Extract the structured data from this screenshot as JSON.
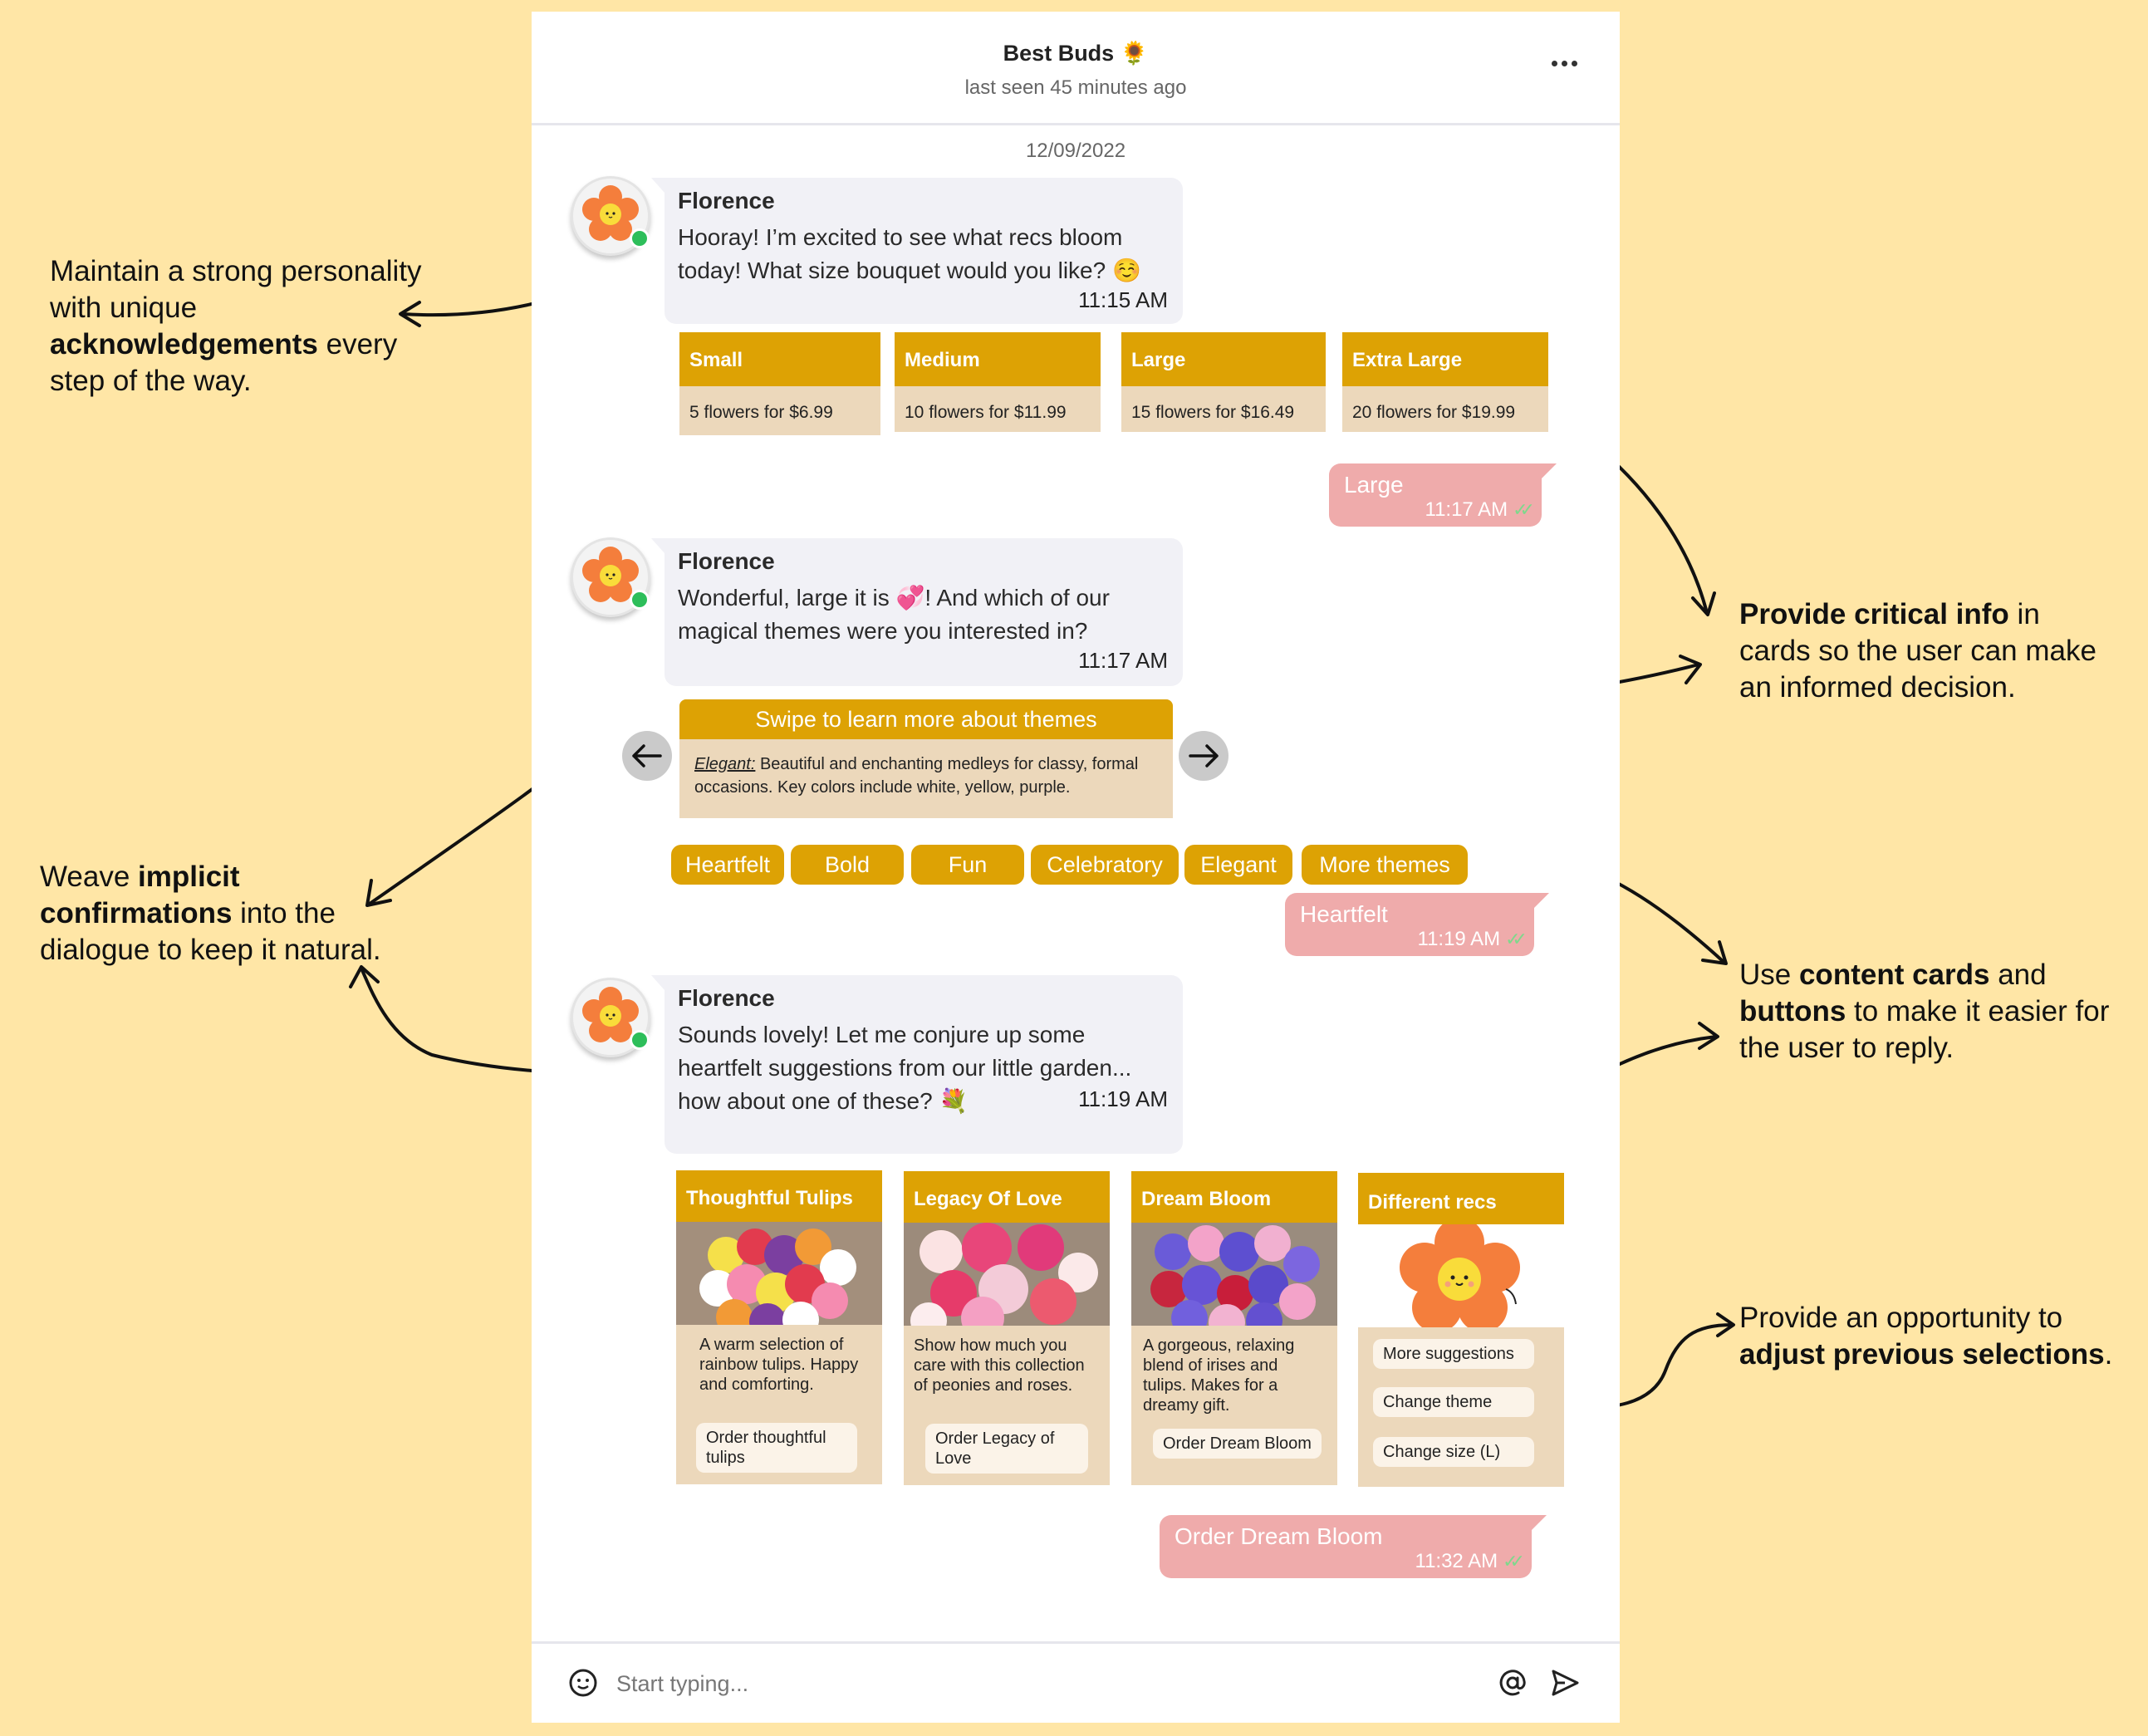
{
  "header": {
    "title": "Best Buds 🌻",
    "subtitle": "last seen 45 minutes ago",
    "more_icon": "ellipsis-icon"
  },
  "date": "12/09/2022",
  "bot": {
    "name": "Florence",
    "status": "online",
    "avatar_icon": "smiling-flower-icon"
  },
  "messages": {
    "m1": {
      "sender": "Florence",
      "text": "Hooray! I’m excited to see what recs bloom today! What size bouquet would you like? ☺️",
      "time": "11:15 AM"
    },
    "m2": {
      "sender": "Florence",
      "text": "Wonderful, large it is 💞! And which of our magical themes were you interested in?",
      "time": "11:17 AM"
    },
    "m3": {
      "sender": "Florence",
      "text": "Sounds lovely! Let me conjure up some heartfelt suggestions from our little garden... how about one of these? 💐",
      "time": "11:19 AM"
    }
  },
  "size_cards": [
    {
      "title": "Small",
      "detail": "5 flowers for $6.99"
    },
    {
      "title": "Medium",
      "detail": "10 flowers for $11.99"
    },
    {
      "title": "Large",
      "detail": "15 flowers for $16.49"
    },
    {
      "title": "Extra Large",
      "detail": "20 flowers for $19.99"
    }
  ],
  "replies": {
    "r1": {
      "text": "Large",
      "time": "11:17 AM",
      "status": "read"
    },
    "r2": {
      "text": "Heartfelt",
      "time": "11:19 AM",
      "status": "read"
    },
    "r3": {
      "text": "Order Dream Bloom",
      "time": "11:32 AM",
      "status": "read"
    }
  },
  "theme_carousel": {
    "header": "Swipe to learn more about themes",
    "theme_name": "Elegant:",
    "description": " Beautiful and enchanting medleys for classy, formal occasions. Key colors include white, yellow, purple.",
    "prev_icon": "arrow-left-icon",
    "next_icon": "arrow-right-icon"
  },
  "theme_chips": [
    "Heartfelt",
    "Bold",
    "Fun",
    "Celebratory",
    "Elegant",
    "More themes"
  ],
  "product_cards": [
    {
      "title": "Thoughtful Tulips",
      "description": "A warm selection of rainbow tulips. Happy and comforting.",
      "button": "Order thoughtful tulips",
      "image": "rainbow-tulips-bouquet"
    },
    {
      "title": "Legacy Of Love",
      "description": "Show how much you care with this collection of peonies and roses.",
      "button": "Order Legacy of Love",
      "image": "peonies-roses-bouquet"
    },
    {
      "title": "Dream Bloom",
      "description": "A gorgeous, relaxing blend of irises and tulips. Makes for a dreamy gift.",
      "button": "Order Dream Bloom",
      "image": "irises-tulips-bouquet"
    }
  ],
  "different_recs": {
    "title": "Different recs",
    "image": "smiling-flower-mascot",
    "buttons": [
      "More suggestions",
      "Change theme",
      "Change size (L)"
    ]
  },
  "composer": {
    "placeholder": "Start typing...",
    "value": "",
    "emoji_icon": "smiley-icon",
    "mention_icon": "at-sign-icon",
    "send_icon": "send-icon"
  },
  "annotations": {
    "a1": {
      "pre": "Maintain a strong personality with unique ",
      "bold": "acknowledgements",
      "post": " every step of the way."
    },
    "a2": {
      "pre": "Weave ",
      "bold": "implicit confirmations",
      "post": " into the dialogue to keep it natural."
    },
    "a3": {
      "pre": "",
      "bold": "Provide critical info",
      "post": " in cards so the user can make an informed decision."
    },
    "a4": {
      "pre": "Use ",
      "bold": "content cards",
      "mid": " and ",
      "bold2": "buttons",
      "post": " to make it easier for the user to reply."
    },
    "a5": {
      "pre": "Provide an opportunity to ",
      "bold": "adjust previous selections",
      "post": "."
    }
  },
  "colors": {
    "background": "#FFE6A6",
    "accent": "#DDA204",
    "card_body": "#ECD8BB",
    "bot_bubble": "#F1F1F6",
    "user_bubble": "#EFABAB",
    "online": "#2DBE5A",
    "read_check": "#7FD88C"
  }
}
